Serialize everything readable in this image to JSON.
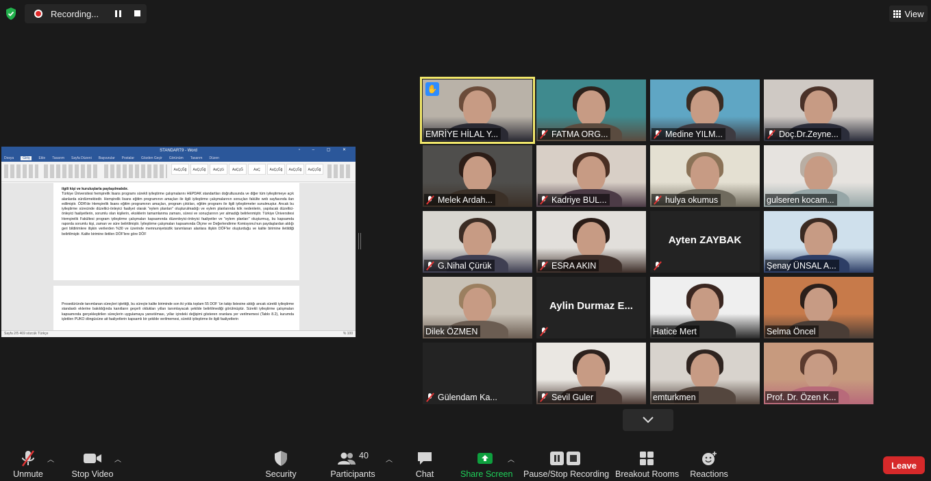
{
  "top_bar": {
    "recording_label": "Recording...",
    "view_label": "View"
  },
  "shared_document": {
    "window_title": "STANDART9 - Word",
    "tabs": [
      "Dosya",
      "Giriş",
      "Ekle",
      "Tasarım",
      "Sayfa Düzeni",
      "Başvurular",
      "Postalar",
      "Gözden Geçir",
      "Görünüm",
      "Tasarım",
      "Düzen"
    ],
    "styles": [
      "AaÇçĞğ",
      "AaÇçĞğ",
      "AaÇçG",
      "AaÇçĞ",
      "AaÇ",
      "AaÇçĞğ",
      "AaÇçĞğ",
      "AaÇçĞğ"
    ],
    "page1_heading": "ilgili kişi ve kuruluşlarla paylaşılmalıdır.",
    "page1_text": "Türkiye Üniversitesi hemşirelik lisans programı sürekli iyileştirme çalışmalarını HEPDAK standartları doğrultusunda ve diğer tüm iyileştirmeye açık alanlarda sürdürmektedir. Hemşirelik lisans eğitim programının amaçları ile ilgili iyileştirme çalışmalarının sonuçları fakülte web sayfasında ilan edilmiştir. ÖDR'de Hemşirelik lisans eğitim programının amaçları, program çıktıları, eğitim programı ile ilgili iyileştirmeler sunulmuştur. Ancak bu iyileştirme sürecinde düzeltici-önleyici faaliyet olarak \"eylem planları\" oluşturulmadığı ve eylem planlarında kök nedenlerin, yapılacak düzeltici-önleyici faaliyetlerin, sorumlu olan kişilerin, eksiklerin tamamlanma zamanı, süresi ve sonuçlarının yer almadığı belirlenmiştir. Türkiye Üniversitesi Hemşirelik Fakültesi program iyileştirme çalışmaları kapsamında düzenleyici-önleyici faaliyetler ve \"eylem planları\" oluşturmuş, bu kapsamda raporda sorumlu kişi, zaman ve süre belirtilmiştir. İyileştirme çalışmaları kapsamında Ölçme ve Değerlendirme Komisyonu'nun paydaşlardan aldığı geri bildirimlere ilişkin verilerden %30 ve üzerinde memnuniyetsizlik tanımlanan alanlara ilişkin DÖF'ler oluşturduğu ve kalite birimine iletildiği belirtilmiştir. Kalite birimine iletilen DÖF'lere göre DÖF",
    "page2_text": "Prosedüründe tanımlanan süreçleri işlettiği, bu süreçte kalite biriminde son iki yılda toplam 55 DÖF 'ün takip listesine aldığı ancak sürekli iyileştirme standardı eklerine bakıldığında kanıtların geçerli oldukları yılları tanımlayacak şekilde belirtilmediği görülmüştür. Sürekli iyileştirme çalışmaları kapsamında gerçekleştirilen süreçlerin uygulamaya yansıtılması, yıllar içindeki değişimi gösteren oranlara yer verilmemesi (Tablo 8.2), kurumda işletilen PUKO döngüsüne ait faaliyetlerin kapsamlı bir şekilde verilmemesi, sürekli iyileştirme ile ilgili faaliyetlerin",
    "status_left": "Sayfa 2/5   469 sözcük   Türkçe",
    "status_right": "% 100"
  },
  "participants": [
    {
      "name": "EMRİYE HİLAL Y...",
      "muted": false,
      "video": true,
      "active": true,
      "hand": true
    },
    {
      "name": "FATMA ORG...",
      "muted": true,
      "video": true
    },
    {
      "name": "Medine YILM...",
      "muted": true,
      "video": true
    },
    {
      "name": "Doç.Dr.Zeyne...",
      "muted": true,
      "video": true
    },
    {
      "name": "Melek Ardah...",
      "muted": true,
      "video": true
    },
    {
      "name": "Kadriye BUL...",
      "muted": true,
      "video": true
    },
    {
      "name": "hulya okumus",
      "muted": true,
      "video": true
    },
    {
      "name": "gulseren kocam...",
      "muted": false,
      "video": true
    },
    {
      "name": "G.Nihal Çürük",
      "muted": true,
      "video": true
    },
    {
      "name": "ESRA AKIN",
      "muted": true,
      "video": true
    },
    {
      "name": "Ayten ZAYBAK",
      "muted": true,
      "video": false
    },
    {
      "name": "Şenay ÜNSAL A...",
      "muted": false,
      "video": true
    },
    {
      "name": "Dilek ÖZMEN",
      "muted": false,
      "video": true
    },
    {
      "name": "Aylin Durmaz E...",
      "muted": true,
      "video": false
    },
    {
      "name": "Hatice Mert",
      "muted": false,
      "video": true
    },
    {
      "name": "Selma Öncel",
      "muted": false,
      "video": true
    },
    {
      "name": "Gülendam Ka...",
      "muted": true,
      "video": false
    },
    {
      "name": "Sevil Guler",
      "muted": true,
      "video": true
    },
    {
      "name": "emturkmen",
      "muted": false,
      "video": true
    },
    {
      "name": "Prof. Dr. Özen K...",
      "muted": false,
      "video": true
    }
  ],
  "toolbar": {
    "unmute": "Unmute",
    "stop_video": "Stop Video",
    "security": "Security",
    "participants": "Participants",
    "participants_count": "40",
    "chat": "Chat",
    "share_screen": "Share Screen",
    "pause_stop_recording": "Pause/Stop Recording",
    "breakout_rooms": "Breakout Rooms",
    "reactions": "Reactions",
    "leave": "Leave"
  },
  "colors": {
    "background": "#1a1a1a",
    "active_speaker": "#f2e86b",
    "share_green": "#0e9f3e",
    "leave_red": "#d6292a",
    "word_blue": "#2b579a",
    "muted_red": "#e23434"
  }
}
